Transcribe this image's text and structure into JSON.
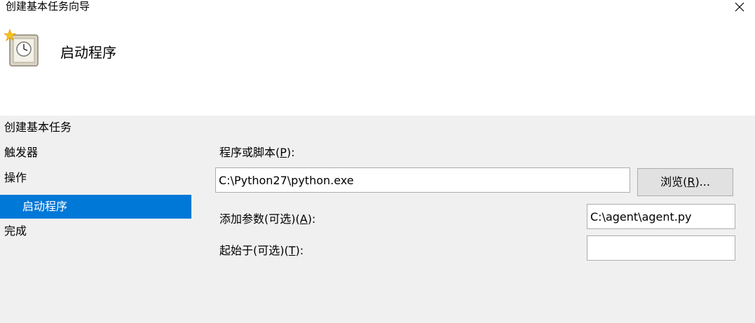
{
  "window": {
    "title": "创建基本任务向导",
    "close_icon": "close-icon"
  },
  "header": {
    "icon": "task-scheduler-clock-icon",
    "title": "启动程序"
  },
  "nav": {
    "items": [
      {
        "label": "创建基本任务",
        "selected": false
      },
      {
        "label": "触发器",
        "selected": false
      },
      {
        "label": "操作",
        "selected": false
      },
      {
        "label": "启动程序",
        "selected": true
      },
      {
        "label": "完成",
        "selected": false
      }
    ]
  },
  "form": {
    "program": {
      "label_prefix": "程序或脚本(",
      "label_key": "P",
      "label_suffix": "):",
      "value": "C:\\Python27\\python.exe"
    },
    "browse": {
      "label_prefix": "浏览(",
      "label_key": "R",
      "label_suffix": ")..."
    },
    "arguments": {
      "label_prefix": "添加参数(可选)(",
      "label_key": "A",
      "label_suffix": "):",
      "value": "C:\\agent\\agent.py"
    },
    "start_in": {
      "label_prefix": "起始于(可选)(",
      "label_key": "T",
      "label_suffix": "):",
      "value": ""
    }
  },
  "colors": {
    "selected_bg": "#0078d7",
    "panel_bg": "#f0f0f0"
  }
}
